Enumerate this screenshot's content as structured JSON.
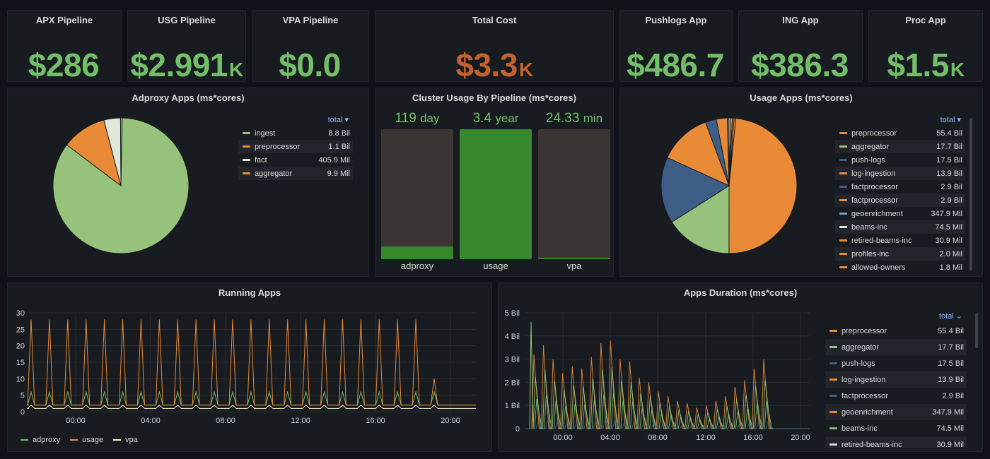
{
  "stats": [
    {
      "title": "APX Pipeline",
      "value": "$286",
      "unit": "",
      "color": "#73bf69"
    },
    {
      "title": "USG Pipeline",
      "value": "$2.991",
      "unit": "K",
      "color": "#73bf69"
    },
    {
      "title": "VPA Pipeline",
      "value": "$0.0",
      "unit": "",
      "color": "#73bf69"
    },
    {
      "title": "Total Cost",
      "value": "$3.3",
      "unit": "K",
      "color": "#c4622d"
    },
    {
      "title": "Pushlogs App",
      "value": "$486.7",
      "unit": "",
      "color": "#73bf69"
    },
    {
      "title": "ING App",
      "value": "$386.3",
      "unit": "",
      "color": "#73bf69"
    },
    {
      "title": "Proc App",
      "value": "$1.5",
      "unit": "K",
      "color": "#73bf69"
    }
  ],
  "adproxy": {
    "title": "Adproxy Apps (ms*cores)",
    "legend_header": "total ▾",
    "chart_data": {
      "type": "pie",
      "title": "Adproxy Apps (ms*cores)",
      "slices": [
        {
          "name": "ingest",
          "value": 8.8,
          "label": "8.8 Bil",
          "color": "#96c27c"
        },
        {
          "name": "preprocessor",
          "value": 1.1,
          "label": "1.1 Bil",
          "color": "#e98b36"
        },
        {
          "name": "fact",
          "value": 0.4059,
          "label": "405.9 Mil",
          "color": "#dfe8d8",
          "pattern": true
        },
        {
          "name": "aggregator",
          "value": 0.0099,
          "label": "9.9 Mil",
          "color": "#e98b36"
        }
      ]
    }
  },
  "cluster": {
    "title": "Cluster Usage By Pipeline (ms*cores)",
    "chart_data": {
      "type": "bar",
      "title": "Cluster Usage By Pipeline (ms*cores)",
      "categories": [
        "adproxy",
        "usage",
        "vpa"
      ],
      "values": [
        0.1,
        1.0,
        0.01
      ],
      "display": [
        {
          "v": "119",
          "u": "day"
        },
        {
          "v": "3.4",
          "u": "year"
        },
        {
          "v": "24.33",
          "u": "min"
        }
      ],
      "color": "#37872d"
    }
  },
  "usage": {
    "title": "Usage Apps (ms*cores)",
    "legend_header": "total ▾",
    "chart_data": {
      "type": "pie",
      "title": "Usage Apps (ms*cores)",
      "slices": [
        {
          "name": "preprocessor",
          "value": 55.4,
          "label": "55.4 Bil",
          "color": "#e98b36"
        },
        {
          "name": "aggregator",
          "value": 17.7,
          "label": "17.7 Bil",
          "color": "#96c27c"
        },
        {
          "name": "push-logs",
          "value": 17.5,
          "label": "17.5 Bil",
          "color": "#3f5e87"
        },
        {
          "name": "log-ingestion",
          "value": 13.9,
          "label": "13.9 Bil",
          "color": "#e98b36"
        },
        {
          "name": "factprocessor",
          "value": 2.9,
          "label": "2.9 Bil",
          "color": "#3f5e87"
        },
        {
          "name": "factprocessor",
          "value": 2.9,
          "label": "2.9 Bil",
          "color": "#e98b36",
          "pattern": true
        },
        {
          "name": "geoenrichment",
          "value": 0.3479,
          "label": "347.9 Mil",
          "color": "#6fa2c8",
          "pattern": true
        },
        {
          "name": "beams-inc",
          "value": 0.0745,
          "label": "74.5 Mil",
          "color": "#dfe8d8"
        },
        {
          "name": "retired-beams-inc",
          "value": 0.0309,
          "label": "30.9 Mil",
          "color": "#e98b36",
          "pattern": true
        },
        {
          "name": "profiles-inc",
          "value": 0.002,
          "label": "2.0 Mil",
          "color": "#e98b36",
          "pattern": true
        },
        {
          "name": "allowed-owners",
          "value": 0.0018,
          "label": "1.8 Mil",
          "color": "#e98b36"
        }
      ]
    }
  },
  "running": {
    "title": "Running Apps",
    "chart_data": {
      "type": "line",
      "title": "Running Apps",
      "ylim": [
        0,
        30
      ],
      "yticks": [
        "0",
        "5",
        "10",
        "15",
        "20",
        "25",
        "30"
      ],
      "xticks": [
        "00:00",
        "04:00",
        "08:00",
        "12:00",
        "16:00",
        "20:00"
      ],
      "series": [
        {
          "name": "adproxy",
          "color": "#73bf69",
          "peak": 6,
          "base": 2
        },
        {
          "name": "usage",
          "color": "#e98b36",
          "peak": 28,
          "base": 2
        },
        {
          "name": "vpa",
          "color": "#f2f2c7",
          "peak": 2,
          "base": 1
        }
      ],
      "peaks_per_series": 23
    }
  },
  "duration": {
    "title": "Apps Duration (ms*cores)",
    "legend_header": "total ⌄",
    "chart_data": {
      "type": "line",
      "title": "Apps Duration (ms*cores)",
      "ylim": [
        0,
        5
      ],
      "yticks": [
        "0",
        "1 Bil",
        "2 Bil",
        "3 Bil",
        "4 Bil",
        "5 Bil"
      ],
      "xticks": [
        "00:00",
        "04:00",
        "08:00",
        "12:00",
        "16:00",
        "20:00"
      ],
      "series": [
        {
          "name": "preprocessor",
          "value": "55.4 Bil",
          "color": "#e98b36"
        },
        {
          "name": "aggregator",
          "value": "17.7 Bil",
          "color": "#96c27c"
        },
        {
          "name": "push-logs",
          "value": "17.5 Bil",
          "color": "#3f5e87"
        },
        {
          "name": "log-ingestion",
          "value": "13.9 Bil",
          "color": "#e98b36"
        },
        {
          "name": "factprocessor",
          "value": "2.9 Bil",
          "color": "#3f5e87"
        },
        {
          "name": "geoenrichment",
          "value": "347.9 Mil",
          "color": "#e98b36"
        },
        {
          "name": "beams-inc",
          "value": "74.5 Mil",
          "color": "#73bf69"
        },
        {
          "name": "retired-beams-inc",
          "value": "30.9 Mil",
          "color": "#d8d9da"
        }
      ]
    }
  }
}
